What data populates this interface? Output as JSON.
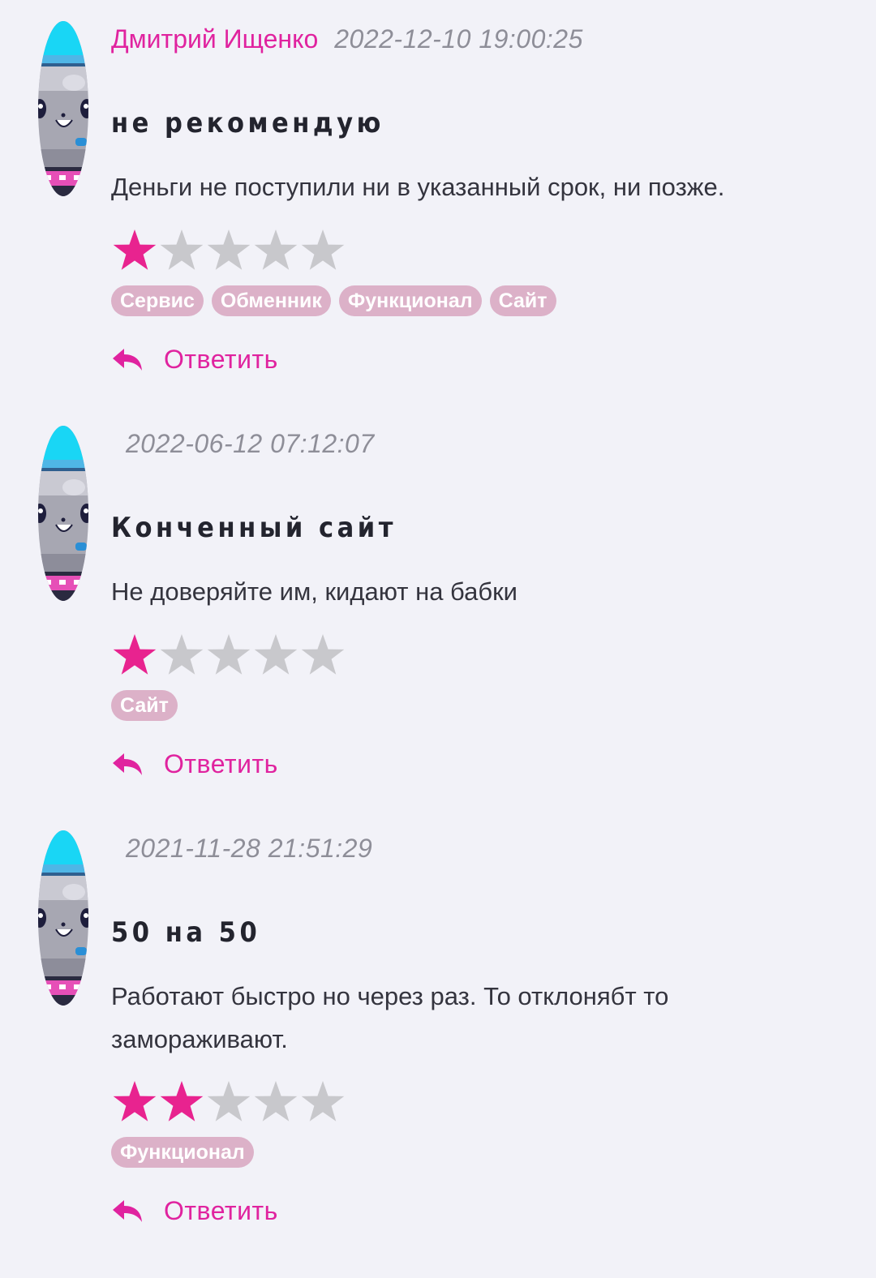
{
  "colors": {
    "accent": "#e0239f",
    "star_on": "#e8238f",
    "star_off": "#c8c8cc",
    "tag_bg": "#dcb1c8",
    "background": "#f2f2f8"
  },
  "icons": {
    "avatar": "cartoon-cat-avatar-icon",
    "reply": "reply-arrow-icon",
    "star": "star-icon"
  },
  "reviews": [
    {
      "author": "Дмитрий Ищенко",
      "date": "2022-12-10 19:00:25",
      "title": "не рекомендую",
      "body": "Деньги не поступили ни в указанный срок, ни позже.",
      "rating": 1,
      "rating_max": 5,
      "tags": [
        "Сервис",
        "Обменник",
        "Функционал",
        "Сайт"
      ],
      "reply_label": "Ответить"
    },
    {
      "author": "",
      "date": "2022-06-12 07:12:07",
      "title": "Конченный сайт",
      "body": "Не доверяйте им, кидают на бабки",
      "rating": 1,
      "rating_max": 5,
      "tags": [
        "Сайт"
      ],
      "reply_label": "Ответить"
    },
    {
      "author": "",
      "date": "2021-11-28 21:51:29",
      "title": "50 на 50",
      "body": "Работают быстро но через раз. То отклонябт то замораживают.",
      "rating": 2,
      "rating_max": 5,
      "tags": [
        "Функционал"
      ],
      "reply_label": "Ответить"
    }
  ]
}
